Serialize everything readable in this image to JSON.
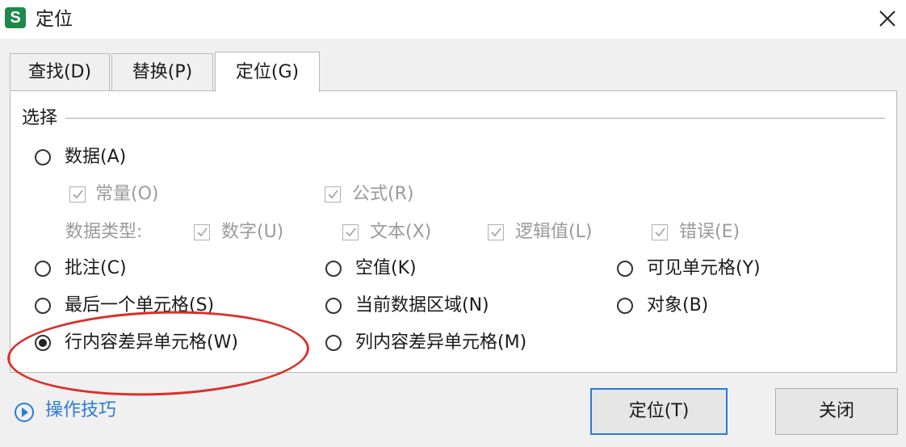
{
  "window": {
    "app_icon_text": "S",
    "title": "定位"
  },
  "tabs": [
    {
      "label": "查找(D)",
      "active": false
    },
    {
      "label": "替换(P)",
      "active": false
    },
    {
      "label": "定位(G)",
      "active": true
    }
  ],
  "section": {
    "label": "选择"
  },
  "options": {
    "data": {
      "label": "数据(A)",
      "checked": false
    },
    "constant": {
      "label": "常量(O)",
      "checked": true
    },
    "formula": {
      "label": "公式(R)",
      "checked": true
    },
    "data_type_label": "数据类型:",
    "number": {
      "label": "数字(U)",
      "checked": true
    },
    "text": {
      "label": "文本(X)",
      "checked": true
    },
    "logical": {
      "label": "逻辑值(L)",
      "checked": true
    },
    "error": {
      "label": "错误(E)",
      "checked": true
    },
    "comment": {
      "label": "批注(C)",
      "checked": false
    },
    "blank": {
      "label": "空值(K)",
      "checked": false
    },
    "visible": {
      "label": "可见单元格(Y)",
      "checked": false
    },
    "last_cell": {
      "label": "最后一个单元格(S)",
      "checked": false
    },
    "current_region": {
      "label": "当前数据区域(N)",
      "checked": false
    },
    "objects": {
      "label": "对象(B)",
      "checked": false
    },
    "row_diff": {
      "label": "行内容差异单元格(W)",
      "checked": true
    },
    "col_diff": {
      "label": "列内容差异单元格(M)",
      "checked": false
    }
  },
  "footer": {
    "tips_label": "操作技巧",
    "goto_button": "定位(T)",
    "close_button": "关闭"
  },
  "colors": {
    "accent": "#2b7bd8",
    "highlight": "#d9302a",
    "app_icon": "#1e8a4a"
  }
}
